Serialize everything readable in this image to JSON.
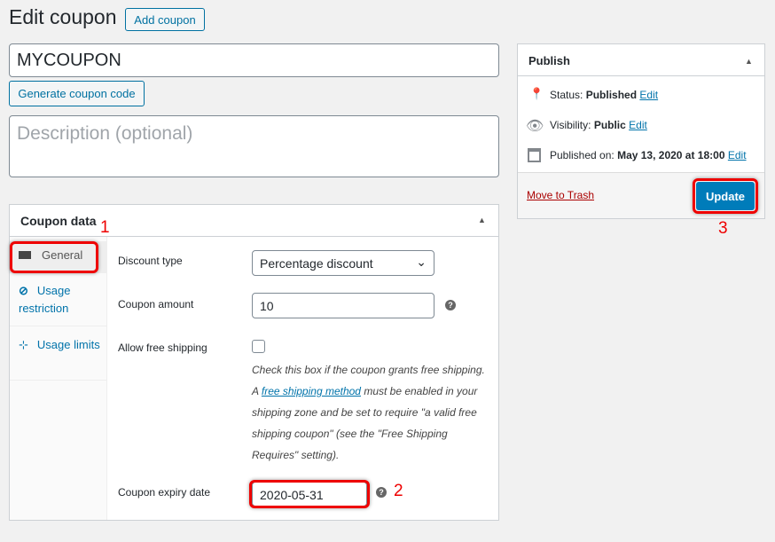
{
  "page": {
    "title": "Edit coupon",
    "add_button": "Add coupon"
  },
  "coupon_code": {
    "value": "MYCOUPON",
    "generate_label": "Generate coupon code"
  },
  "description": {
    "placeholder": "Description (optional)"
  },
  "coupon_data": {
    "title": "Coupon data",
    "tabs": [
      {
        "label": "General",
        "icon": "ticket-icon"
      },
      {
        "label": "Usage restriction",
        "icon": "ban-icon"
      },
      {
        "label": "Usage limits",
        "icon": "limits-icon"
      }
    ],
    "discount_type": {
      "label": "Discount type",
      "value": "Percentage discount"
    },
    "coupon_amount": {
      "label": "Coupon amount",
      "value": "10"
    },
    "free_shipping": {
      "label": "Allow free shipping",
      "checked": false,
      "desc_1": "Check this box if the coupon grants free shipping. A ",
      "desc_link": "free shipping method",
      "desc_2": " must be enabled in your shipping zone and be set to require \"a valid free shipping coupon\" (see the \"Free Shipping Requires\" setting)."
    },
    "expiry": {
      "label": "Coupon expiry date",
      "value": "2020-05-31"
    }
  },
  "publish": {
    "title": "Publish",
    "status_label": "Status:",
    "status_value": "Published",
    "visibility_label": "Visibility:",
    "visibility_value": "Public",
    "published_label": "Published on:",
    "published_value": "May 13, 2020 at 18:00",
    "edit": "Edit",
    "trash": "Move to Trash",
    "update": "Update"
  },
  "annotations": [
    "1",
    "2",
    "3"
  ],
  "colors": {
    "accent": "#0073aa",
    "update_button": "#007cba",
    "highlight": "#e00000"
  }
}
